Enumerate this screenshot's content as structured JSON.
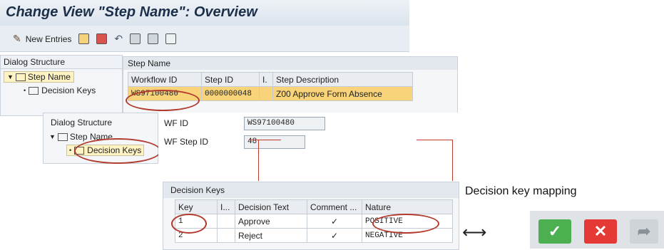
{
  "window": {
    "title": "Change View \"Step Name\": Overview"
  },
  "toolbar": {
    "new_entries": "New Entries"
  },
  "panel1": {
    "dialog_structure": "Dialog Structure",
    "tree": [
      "Step Name",
      "Decision Keys"
    ],
    "table_title": "Step Name",
    "columns": [
      "Workflow ID",
      "Step ID",
      "I.",
      "Step Description"
    ],
    "row": {
      "wf": "WS97100480",
      "step": "0000000048",
      "desc": "Z00 Approve Form Absence"
    }
  },
  "panel2": {
    "dialog_structure": "Dialog Structure",
    "tree": [
      "Step Name",
      "Decision Keys"
    ],
    "wf_id_label": "WF ID",
    "wf_id_value": "WS97100480",
    "wf_step_label": "WF Step ID",
    "wf_step_value": "48"
  },
  "decision_keys": {
    "title": "Decision Keys",
    "columns": [
      "Key",
      "I...",
      "Decision Text",
      "Comment ...",
      "Nature"
    ],
    "rows": [
      {
        "key": "1",
        "text": "Approve",
        "comment": "✓",
        "nature": "POSITIVE"
      },
      {
        "key": "2",
        "text": "Reject",
        "comment": "✓",
        "nature": "NEGATIVE"
      }
    ]
  },
  "annotation": {
    "mapping_label": "Decision key mapping",
    "arrow": "⟷"
  },
  "buttons": {
    "approve": "✓",
    "reject": "✕",
    "forward": "➦"
  },
  "colors": {
    "highlight_row": "#f8d37a",
    "oval": "#b23a2e",
    "approve": "#4caf50",
    "reject": "#e53935"
  }
}
